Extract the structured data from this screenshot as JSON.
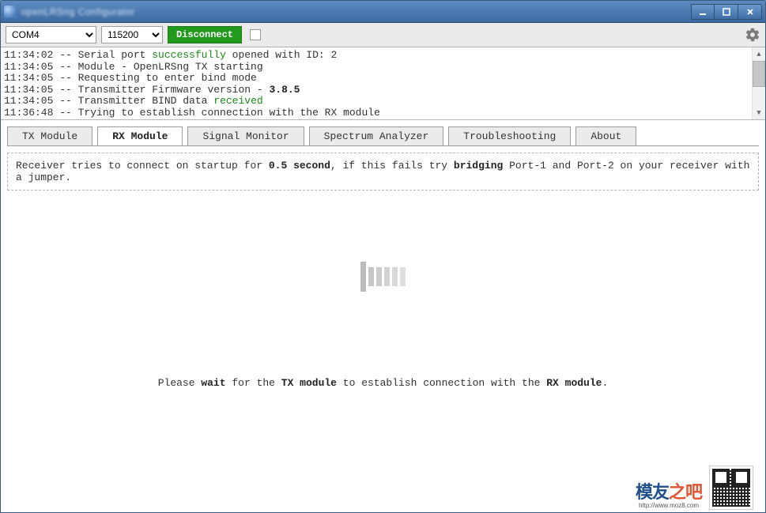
{
  "window": {
    "title_blur": "openLRSng Configurator"
  },
  "toolbar": {
    "port_options": [
      "COM4"
    ],
    "port_selected": "COM4",
    "baud_options": [
      "115200"
    ],
    "baud_selected": "115200",
    "button_label": "Disconnect",
    "checkbox_checked": false
  },
  "log": {
    "lines": [
      {
        "time": "11:34:02",
        "segments": [
          {
            "t": "Serial port "
          },
          {
            "t": "successfully",
            "cls": "green"
          },
          {
            "t": " opened with ID: 2"
          }
        ]
      },
      {
        "time": "11:34:05",
        "segments": [
          {
            "t": "Module - OpenLRSng TX starting"
          }
        ]
      },
      {
        "time": "11:34:05",
        "segments": [
          {
            "t": "Requesting to enter bind mode"
          }
        ]
      },
      {
        "time": "11:34:05",
        "segments": [
          {
            "t": "Transmitter Firmware version - "
          },
          {
            "t": "3.8.5",
            "cls": "bold dark"
          }
        ]
      },
      {
        "time": "11:34:05",
        "segments": [
          {
            "t": "Transmitter BIND data "
          },
          {
            "t": "received",
            "cls": "green"
          }
        ]
      },
      {
        "time": "11:36:48",
        "segments": [
          {
            "t": "Trying to establish connection with the RX module"
          }
        ]
      }
    ]
  },
  "tabs": {
    "items": [
      "TX Module",
      "RX Module",
      "Signal Monitor",
      "Spectrum Analyzer",
      "Troubleshooting",
      "About"
    ],
    "active_index": 1
  },
  "hint": {
    "pre": "Receiver tries to connect on startup for ",
    "duration": "0.5 second",
    "mid": ", if this fails try ",
    "action": "bridging",
    "post": " Port-1 and Port-2 on your receiver with a jumper."
  },
  "wait_message": {
    "pre": "Please ",
    "w1": "wait",
    "mid1": " for the ",
    "w2": "TX module",
    "mid2": " to establish connection with the ",
    "w3": "RX module",
    "post": "."
  },
  "footer": {
    "logo_main_1": "模友",
    "logo_main_2": "之吧",
    "logo_sub": "http://www.moz8.com"
  }
}
